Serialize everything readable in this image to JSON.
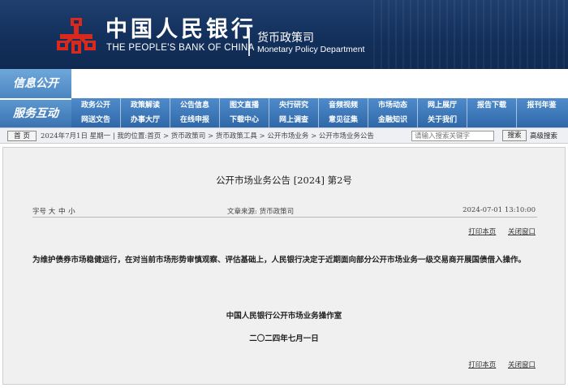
{
  "header": {
    "bank_name_cn": "中国人民银行",
    "bank_name_en": "THE PEOPLE'S BANK OF CHINA",
    "dept_cn": "货币政策司",
    "dept_en": "Monetary Policy Department",
    "logo_color": "#d9281c"
  },
  "nav": {
    "section1": "信息公开",
    "section2": "服务互动",
    "row1": [
      "政务公开",
      "政策解读",
      "公告信息",
      "图文直播",
      "央行研究",
      "音频视频",
      "市场动态",
      "网上展厅",
      "报告下载",
      "报刊年鉴"
    ],
    "row2": [
      "网送文告",
      "办事大厅",
      "在线申报",
      "下载中心",
      "网上调查",
      "意见征集",
      "金融知识",
      "关于我们",
      "",
      ""
    ]
  },
  "breadcrumb": {
    "home_label": "首 页",
    "text": "2024年7月1日 星期一 | 我的位置:首页 > 货币政策司 > 货币政策工具 > 公开市场业务 > 公开市场业务公告",
    "search_placeholder": "请输入搜索关键字",
    "search_button": "搜索",
    "advanced_search": "高级搜索"
  },
  "article": {
    "title": "公开市场业务公告 [2024] 第2号",
    "font_size_label": "字号",
    "font_sizes": [
      "大",
      "中",
      "小"
    ],
    "source": "文章来源:  货币政策司",
    "date": "2024-07-01 13:10:00",
    "print": "打印本页",
    "close": "关闭窗口",
    "body": "为维护债券市场稳健运行，在对当前市场形势审慎观察、评估基础上，人民银行决定于近期面向部分公开市场业务一级交易商开展国债借入操作。",
    "signature_org": "中国人民银行公开市场业务操作室",
    "signature_date": "二〇二四年七月一日"
  }
}
